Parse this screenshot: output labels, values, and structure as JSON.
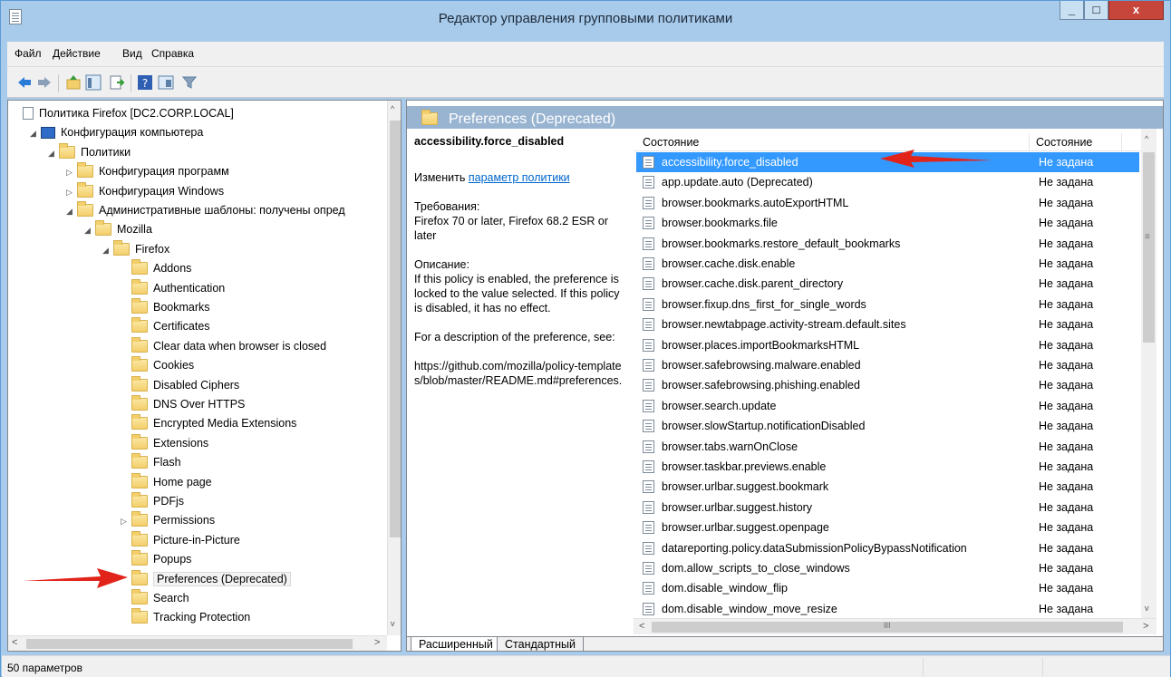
{
  "window": {
    "title": "Редактор управления групповыми политиками"
  },
  "menu": [
    "Файл",
    "Действие",
    "Вид",
    "Справка"
  ],
  "tree": [
    {
      "label": "Политика Firefox [DC2.CORP.LOCAL]",
      "indent": 0,
      "exp": "",
      "icon": "doc"
    },
    {
      "label": "Конфигурация компьютера",
      "indent": 1,
      "exp": "◢",
      "icon": "computer"
    },
    {
      "label": "Политики",
      "indent": 2,
      "exp": "◢",
      "icon": "folder"
    },
    {
      "label": "Конфигурация программ",
      "indent": 3,
      "exp": "▷",
      "icon": "folder"
    },
    {
      "label": "Конфигурация Windows",
      "indent": 3,
      "exp": "▷",
      "icon": "folder"
    },
    {
      "label": "Административные шаблоны: получены опред",
      "indent": 3,
      "exp": "◢",
      "icon": "folder"
    },
    {
      "label": "Mozilla",
      "indent": 4,
      "exp": "◢",
      "icon": "folder"
    },
    {
      "label": "Firefox",
      "indent": 5,
      "exp": "◢",
      "icon": "folder"
    },
    {
      "label": "Addons",
      "indent": 6,
      "exp": "",
      "icon": "folder"
    },
    {
      "label": "Authentication",
      "indent": 6,
      "exp": "",
      "icon": "folder"
    },
    {
      "label": "Bookmarks",
      "indent": 6,
      "exp": "",
      "icon": "folder"
    },
    {
      "label": "Certificates",
      "indent": 6,
      "exp": "",
      "icon": "folder"
    },
    {
      "label": "Clear data when browser is closed",
      "indent": 6,
      "exp": "",
      "icon": "folder"
    },
    {
      "label": "Cookies",
      "indent": 6,
      "exp": "",
      "icon": "folder"
    },
    {
      "label": "Disabled Ciphers",
      "indent": 6,
      "exp": "",
      "icon": "folder"
    },
    {
      "label": "DNS Over HTTPS",
      "indent": 6,
      "exp": "",
      "icon": "folder"
    },
    {
      "label": "Encrypted Media Extensions",
      "indent": 6,
      "exp": "",
      "icon": "folder"
    },
    {
      "label": "Extensions",
      "indent": 6,
      "exp": "",
      "icon": "folder"
    },
    {
      "label": "Flash",
      "indent": 6,
      "exp": "",
      "icon": "folder"
    },
    {
      "label": "Home page",
      "indent": 6,
      "exp": "",
      "icon": "folder"
    },
    {
      "label": "PDFjs",
      "indent": 6,
      "exp": "",
      "icon": "folder"
    },
    {
      "label": "Permissions",
      "indent": 6,
      "exp": "▷",
      "icon": "folder"
    },
    {
      "label": "Picture-in-Picture",
      "indent": 6,
      "exp": "",
      "icon": "folder"
    },
    {
      "label": "Popups",
      "indent": 6,
      "exp": "",
      "icon": "folder"
    },
    {
      "label": "Preferences (Deprecated)",
      "indent": 6,
      "exp": "",
      "icon": "folder",
      "selected": true
    },
    {
      "label": "Search",
      "indent": 6,
      "exp": "",
      "icon": "folder"
    },
    {
      "label": "Tracking Protection",
      "indent": 6,
      "exp": "",
      "icon": "folder"
    }
  ],
  "right": {
    "header": "Preferences (Deprecated)",
    "desc": {
      "policy_name": "accessibility.force_disabled",
      "edit_prefix": "Изменить ",
      "edit_link": "параметр политики",
      "req_label": "Требования:",
      "req_text": "Firefox 70 or later, Firefox 68.2 ESR or later",
      "desc_label": "Описание:",
      "desc_text": "If this policy is enabled, the preference is locked to the value selected. If this policy is disabled, it has no effect.",
      "more_text": "For a description of the preference, see:",
      "url": "https://github.com/mozilla/policy-templates/blob/master/README.md#preferences."
    },
    "columns": {
      "name": "Состояние",
      "state": "Состояние"
    },
    "rows": [
      {
        "name": "accessibility.force_disabled",
        "state": "Не задана",
        "selected": true
      },
      {
        "name": "app.update.auto (Deprecated)",
        "state": "Не задана"
      },
      {
        "name": "browser.bookmarks.autoExportHTML",
        "state": "Не задана"
      },
      {
        "name": "browser.bookmarks.file",
        "state": "Не задана"
      },
      {
        "name": "browser.bookmarks.restore_default_bookmarks",
        "state": "Не задана"
      },
      {
        "name": "browser.cache.disk.enable",
        "state": "Не задана"
      },
      {
        "name": "browser.cache.disk.parent_directory",
        "state": "Не задана"
      },
      {
        "name": "browser.fixup.dns_first_for_single_words",
        "state": "Не задана"
      },
      {
        "name": "browser.newtabpage.activity-stream.default.sites",
        "state": "Не задана"
      },
      {
        "name": "browser.places.importBookmarksHTML",
        "state": "Не задана"
      },
      {
        "name": "browser.safebrowsing.malware.enabled",
        "state": "Не задана"
      },
      {
        "name": "browser.safebrowsing.phishing.enabled",
        "state": "Не задана"
      },
      {
        "name": "browser.search.update",
        "state": "Не задана"
      },
      {
        "name": "browser.slowStartup.notificationDisabled",
        "state": "Не задана"
      },
      {
        "name": "browser.tabs.warnOnClose",
        "state": "Не задана"
      },
      {
        "name": "browser.taskbar.previews.enable",
        "state": "Не задана"
      },
      {
        "name": "browser.urlbar.suggest.bookmark",
        "state": "Не задана"
      },
      {
        "name": "browser.urlbar.suggest.history",
        "state": "Не задана"
      },
      {
        "name": "browser.urlbar.suggest.openpage",
        "state": "Не задана"
      },
      {
        "name": "datareporting.policy.dataSubmissionPolicyBypassNotification",
        "state": "Не задана"
      },
      {
        "name": "dom.allow_scripts_to_close_windows",
        "state": "Не задана"
      },
      {
        "name": "dom.disable_window_flip",
        "state": "Не задана"
      },
      {
        "name": "dom.disable_window_move_resize",
        "state": "Не задана"
      }
    ],
    "tabs": [
      "Расширенный",
      "Стандартный"
    ]
  },
  "status": "50 параметров",
  "colors": {
    "titlebar": "#a9cbeb",
    "selection": "#3399ff",
    "annotation_arrow": "#e2231a"
  }
}
